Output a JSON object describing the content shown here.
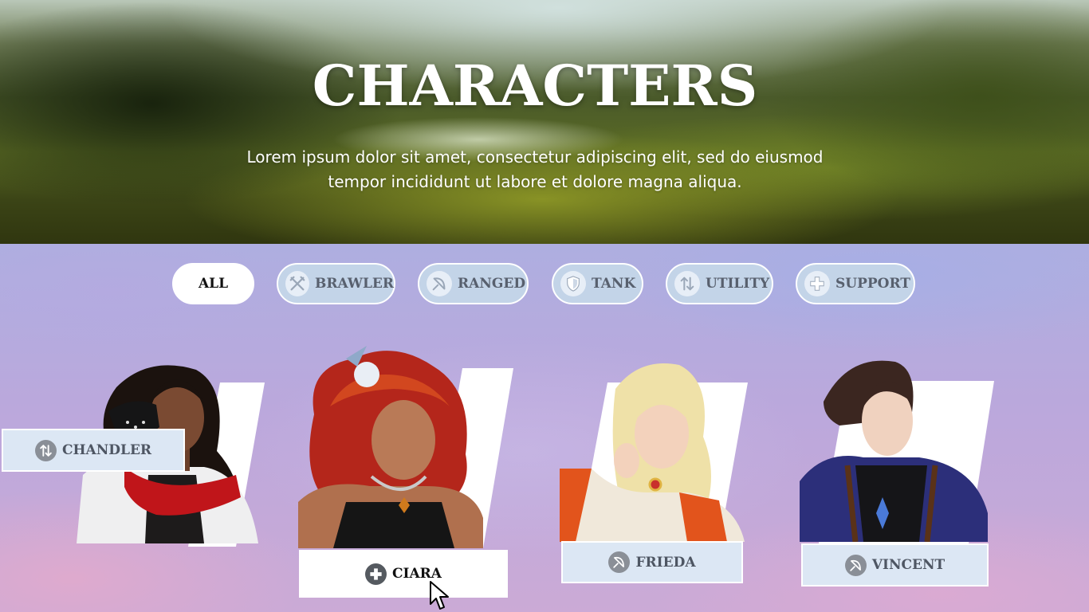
{
  "hero": {
    "title": "CHARACTERS",
    "subtitle": "Lorem ipsum dolor sit amet, consectetur adipiscing elit, sed do eiusmod tempor incididunt ut labore et dolore magna aliqua."
  },
  "filters": [
    {
      "label": "ALL",
      "icon": null,
      "active": true
    },
    {
      "label": "BRAWLER",
      "icon": "crossed-swords-icon",
      "active": false
    },
    {
      "label": "RANGED",
      "icon": "bow-arrow-icon",
      "active": false
    },
    {
      "label": "TANK",
      "icon": "shield-icon",
      "active": false
    },
    {
      "label": "UTILITY",
      "icon": "up-down-arrows-icon",
      "active": false
    },
    {
      "label": "SUPPORT",
      "icon": "plus-icon",
      "active": false
    }
  ],
  "characters": [
    {
      "name": "CHANDLER",
      "role_icon": "up-down-arrows-icon",
      "selected": false
    },
    {
      "name": "CIARA",
      "role_icon": "plus-icon",
      "selected": true
    },
    {
      "name": "FRIEDA",
      "role_icon": "bow-arrow-icon",
      "selected": false
    },
    {
      "name": "VINCENT",
      "role_icon": "bow-arrow-icon",
      "selected": false
    }
  ],
  "colors": {
    "pill_bg": "#c3d4e8",
    "pill_active_bg": "#ffffff",
    "nameplate_bg": "#dce7f4",
    "accent_white": "#ffffff"
  }
}
